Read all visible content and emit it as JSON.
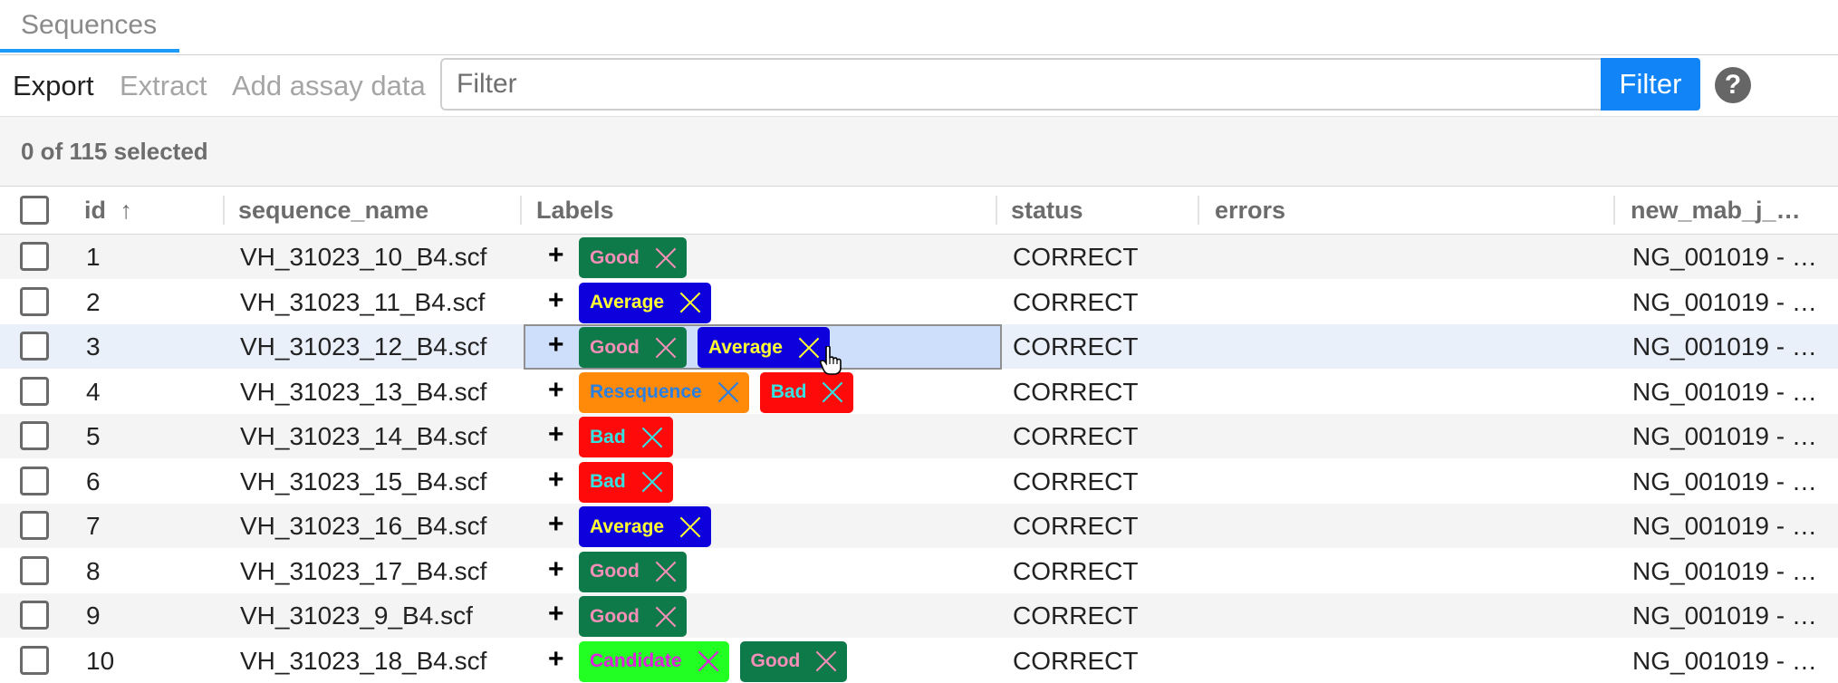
{
  "tabs": [
    {
      "label": "Sequences",
      "active": true
    }
  ],
  "toolbar": {
    "export": "Export",
    "extract": "Extract",
    "add_assay": "Add assay data",
    "filter_placeholder": "Filter",
    "filter_button": "Filter",
    "help": "?"
  },
  "selection_text": "0 of 115 selected",
  "columns": {
    "id": "id",
    "sort_indicator": "↑",
    "sequence_name": "sequence_name",
    "labels": "Labels",
    "status": "status",
    "errors": "errors",
    "new_mab": "new_mab_j_…"
  },
  "label_add": "+",
  "label_colors": {
    "Good": {
      "bg": "#0e7a4a",
      "fg": "#f58fb8"
    },
    "Average": {
      "bg": "#0d00dc",
      "fg": "#ffff33"
    },
    "Resequence": {
      "bg": "#ff8a0a",
      "fg": "#2a7fe0"
    },
    "Bad": {
      "bg": "#ff0a0a",
      "fg": "#35e0e0"
    },
    "Candidate": {
      "bg": "#22ff22",
      "fg": "#dd22dd"
    }
  },
  "rows": [
    {
      "id": "1",
      "sequence_name": "VH_31023_10_B4.scf",
      "labels": [
        "Good"
      ],
      "status": "CORRECT",
      "errors": "",
      "new_mab": "NG_001019 - …"
    },
    {
      "id": "2",
      "sequence_name": "VH_31023_11_B4.scf",
      "labels": [
        "Average"
      ],
      "status": "CORRECT",
      "errors": "",
      "new_mab": "NG_001019 - …"
    },
    {
      "id": "3",
      "sequence_name": "VH_31023_12_B4.scf",
      "labels": [
        "Good",
        "Average"
      ],
      "status": "CORRECT",
      "errors": "",
      "new_mab": "NG_001019 - …"
    },
    {
      "id": "4",
      "sequence_name": "VH_31023_13_B4.scf",
      "labels": [
        "Resequence",
        "Bad"
      ],
      "status": "CORRECT",
      "errors": "",
      "new_mab": "NG_001019 - …"
    },
    {
      "id": "5",
      "sequence_name": "VH_31023_14_B4.scf",
      "labels": [
        "Bad"
      ],
      "status": "CORRECT",
      "errors": "",
      "new_mab": "NG_001019 - …"
    },
    {
      "id": "6",
      "sequence_name": "VH_31023_15_B4.scf",
      "labels": [
        "Bad"
      ],
      "status": "CORRECT",
      "errors": "",
      "new_mab": "NG_001019 - …"
    },
    {
      "id": "7",
      "sequence_name": "VH_31023_16_B4.scf",
      "labels": [
        "Average"
      ],
      "status": "CORRECT",
      "errors": "",
      "new_mab": "NG_001019 - …"
    },
    {
      "id": "8",
      "sequence_name": "VH_31023_17_B4.scf",
      "labels": [
        "Good"
      ],
      "status": "CORRECT",
      "errors": "",
      "new_mab": "NG_001019 - …"
    },
    {
      "id": "9",
      "sequence_name": "VH_31023_9_B4.scf",
      "labels": [
        "Good"
      ],
      "status": "CORRECT",
      "errors": "",
      "new_mab": "NG_001019 - …"
    },
    {
      "id": "10",
      "sequence_name": "VH_31023_18_B4.scf",
      "labels": [
        "Candidate",
        "Good"
      ],
      "status": "CORRECT",
      "errors": "",
      "new_mab": "NG_001019 - …"
    }
  ]
}
